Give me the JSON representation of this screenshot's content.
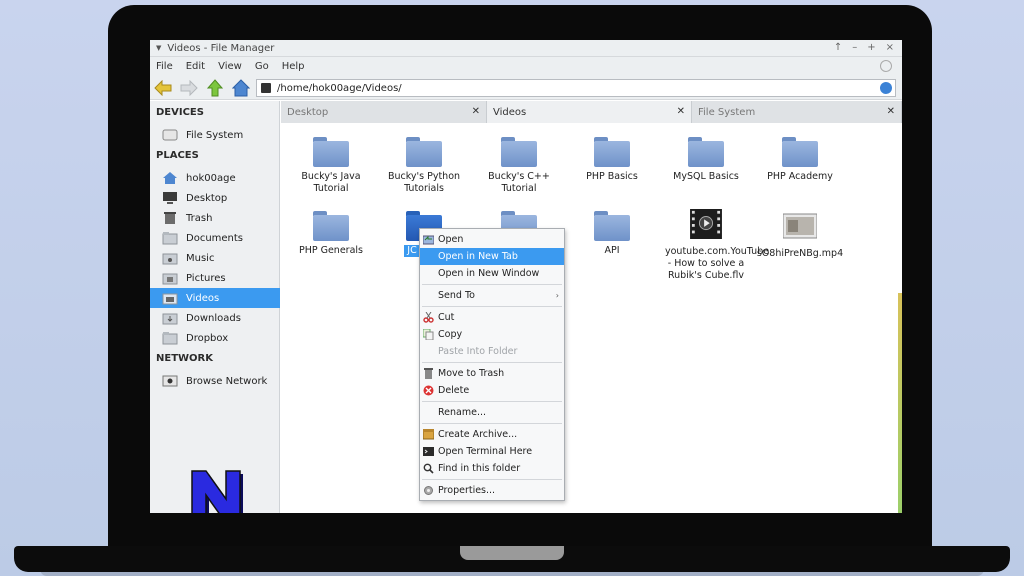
{
  "window": {
    "title": "Videos - File Manager",
    "controls": [
      "↑",
      "–",
      "+",
      "×"
    ]
  },
  "menu": [
    "File",
    "Edit",
    "View",
    "Go",
    "Help"
  ],
  "path": "/home/hok00age/Videos/",
  "sidebar": {
    "devices_heading": "DEVICES",
    "places_heading": "PLACES",
    "network_heading": "NETWORK",
    "devices": [
      {
        "label": "File System",
        "icon": "drive-icon"
      }
    ],
    "places": [
      {
        "label": "hok00age",
        "icon": "home-icon"
      },
      {
        "label": "Desktop",
        "icon": "desktop-icon"
      },
      {
        "label": "Trash",
        "icon": "trash-icon"
      },
      {
        "label": "Documents",
        "icon": "folder-icon"
      },
      {
        "label": "Music",
        "icon": "music-folder-icon"
      },
      {
        "label": "Pictures",
        "icon": "pictures-folder-icon"
      },
      {
        "label": "Videos",
        "icon": "videos-folder-icon",
        "selected": true
      },
      {
        "label": "Downloads",
        "icon": "downloads-folder-icon"
      },
      {
        "label": "Dropbox",
        "icon": "folder-icon"
      }
    ],
    "network": [
      {
        "label": "Browse Network",
        "icon": "network-icon"
      }
    ]
  },
  "tabs": [
    {
      "label": "Desktop",
      "active": false
    },
    {
      "label": "Videos",
      "active": true
    },
    {
      "label": "File System",
      "active": false
    }
  ],
  "files": [
    {
      "label": "Bucky's Java Tutorial",
      "type": "folder"
    },
    {
      "label": "Bucky's Python Tutorials",
      "type": "folder"
    },
    {
      "label": "Bucky's C++ Tutorial",
      "type": "folder"
    },
    {
      "label": "PHP Basics",
      "type": "folder"
    },
    {
      "label": "MySQL Basics",
      "type": "folder"
    },
    {
      "label": "PHP Academy",
      "type": "folder"
    },
    {
      "label": "PHP Generals",
      "type": "folder"
    },
    {
      "label": "JC",
      "type": "folder",
      "selected": true
    },
    {
      "label": "",
      "type": "folder"
    },
    {
      "label": "API",
      "type": "folder"
    },
    {
      "label": "youtube.com.YouTube - How to solve a Rubik's Cube.flv",
      "type": "video"
    },
    {
      "label": "sO8hiPreNBg.mp4",
      "type": "video"
    }
  ],
  "context_menu": [
    {
      "label": "Open",
      "icon": "open-icon"
    },
    {
      "label": "Open in New Tab",
      "highlighted": true
    },
    {
      "label": "Open in New Window"
    },
    {
      "label": "Send To",
      "submenu": true
    },
    {
      "label": "Cut",
      "icon": "scissors-icon"
    },
    {
      "label": "Copy",
      "icon": "copy-icon"
    },
    {
      "label": "Paste Into Folder",
      "disabled": true
    },
    {
      "label": "Move to Trash",
      "icon": "trash-icon"
    },
    {
      "label": "Delete",
      "icon": "delete-icon"
    },
    {
      "label": "Rename..."
    },
    {
      "label": "Create Archive...",
      "icon": "archive-icon"
    },
    {
      "label": "Open Terminal Here",
      "icon": "terminal-icon"
    },
    {
      "label": "Find in this folder",
      "icon": "search-icon"
    },
    {
      "label": "Properties...",
      "icon": "gear-icon"
    }
  ],
  "colors": {
    "accent": "#3b9af0",
    "bezel": "#0a0a0a",
    "background": "#c9d4ee",
    "logo": "#2a2ae0"
  }
}
